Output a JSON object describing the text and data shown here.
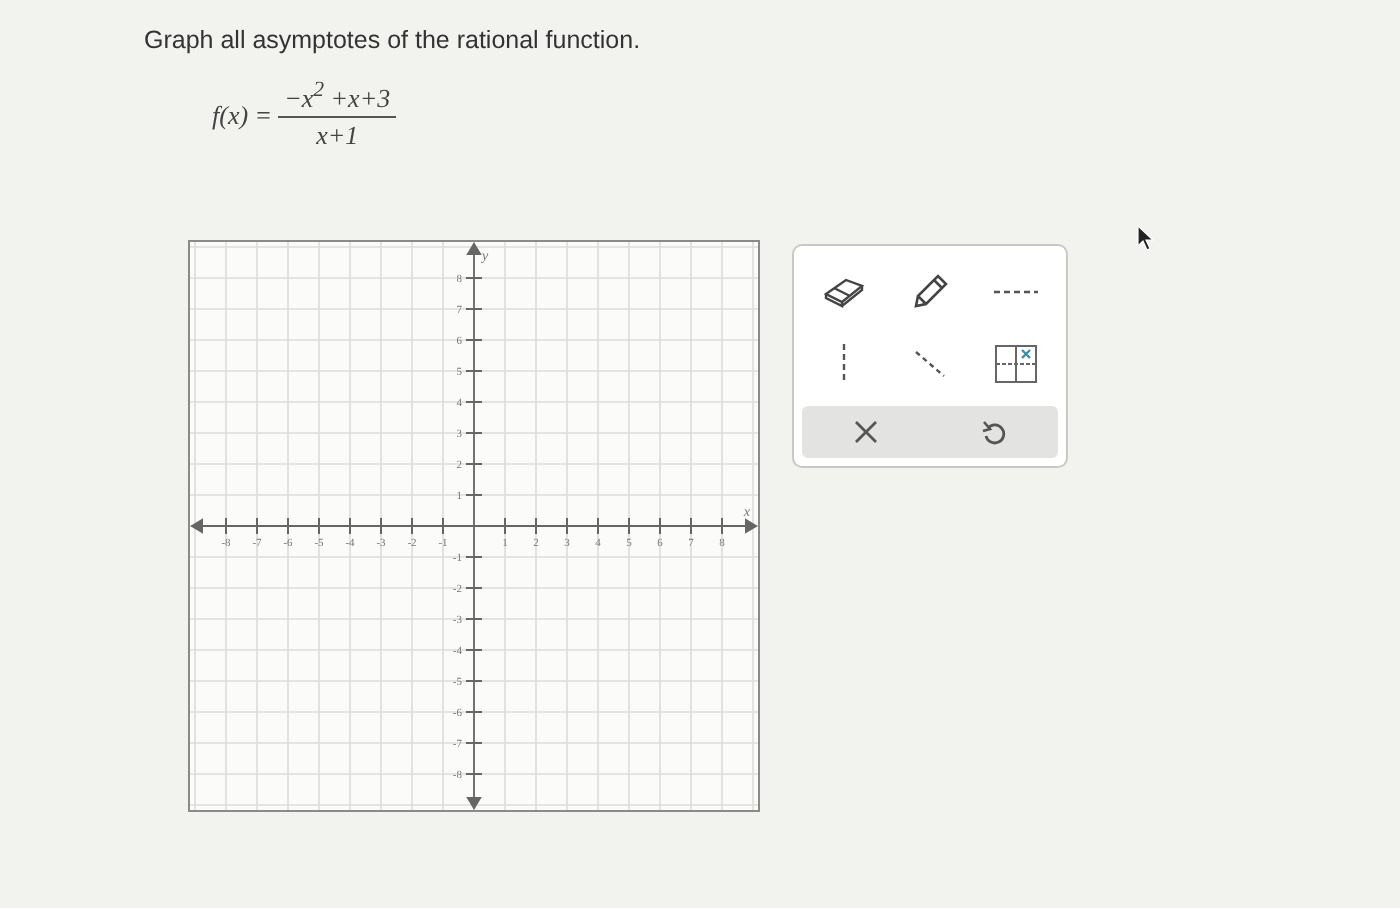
{
  "instruction": "Graph all asymptotes of the rational function.",
  "function": {
    "name": "f(x) =",
    "numerator": "−x$^{2}$ +x+3",
    "denominator": "x+1"
  },
  "graph": {
    "x_axis_label": "x",
    "y_axis_label": "y",
    "x_ticks": [
      "-8",
      "-7",
      "-6",
      "-5",
      "-4",
      "-3",
      "-2",
      "-1",
      "1",
      "2",
      "3",
      "4",
      "5",
      "6",
      "7",
      "8"
    ],
    "y_ticks": [
      "8",
      "7",
      "6",
      "5",
      "4",
      "3",
      "2",
      "1",
      "-1",
      "-2",
      "-3",
      "-4",
      "-5",
      "-6",
      "-7",
      "-8"
    ]
  },
  "tools": [
    {
      "kind": "eraser"
    },
    {
      "kind": "pencil"
    },
    {
      "kind": "hline"
    },
    {
      "kind": "vline"
    },
    {
      "kind": "slant"
    },
    {
      "kind": "gridx"
    }
  ],
  "actions": [
    {
      "kind": "clear"
    },
    {
      "kind": "undo"
    }
  ]
}
